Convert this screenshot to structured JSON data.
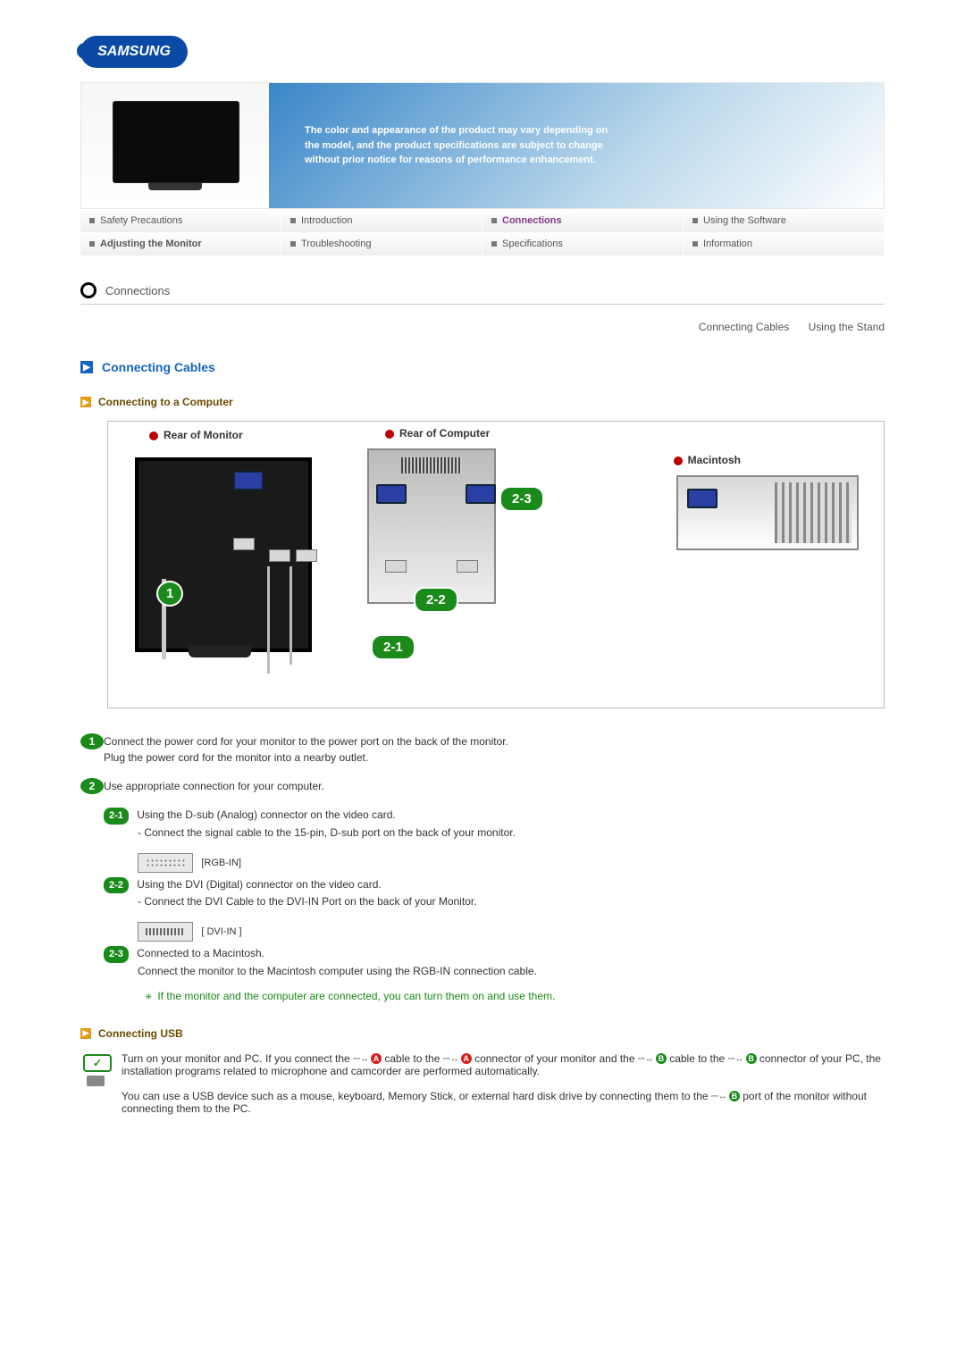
{
  "brand": "SAMSUNG",
  "hero": {
    "disclaimer": "The color and appearance of the product may vary depending on the model, and the product specifications are subject to change without prior notice for reasons of performance enhancement."
  },
  "tabs": {
    "row1": [
      "Safety Precautions",
      "Introduction",
      "Connections",
      "Using the Software"
    ],
    "row2": [
      "Adjusting the Monitor",
      "Troubleshooting",
      "Specifications",
      "Information"
    ]
  },
  "breadcrumb": "Connections",
  "subnav": [
    "Connecting Cables",
    "Using the Stand"
  ],
  "section": {
    "title": "Connecting Cables",
    "sub1": "Connecting to a Computer",
    "diagram": {
      "rear_monitor": "Rear of Monitor",
      "rear_computer": "Rear of Computer",
      "macintosh": "Macintosh",
      "c1": "1",
      "c21": "2-1",
      "c22": "2-2",
      "c23": "2-3"
    },
    "steps": {
      "s1a": "Connect the power cord for your monitor to the power port on the back of the monitor.",
      "s1b": "Plug the power cord for the monitor into a nearby outlet.",
      "s2": "Use appropriate connection for your computer.",
      "s21a": "Using the D-sub (Analog) connector on the video card.",
      "s21b": "- Connect the signal cable to the 15-pin, D-sub port on the back of your monitor.",
      "rgb": "[RGB-IN]",
      "s22a": "Using the DVI (Digital) connector on the video card.",
      "s22b": "- Connect the DVI Cable to the DVI-IN Port on the back of your Monitor.",
      "dvi": "[ DVI-IN ]",
      "s23a": "Connected to a Macintosh.",
      "s23b": "Connect the monitor to the Macintosh computer using the RGB-IN connection cable.",
      "note": "If the monitor and the computer are connected, you can turn them on and use them."
    },
    "sub2": "Connecting USB",
    "usb": {
      "p1a": "Turn on your monitor and PC. If you connect the ",
      "p1b": " cable to the ",
      "p1c": " connector of your monitor and the ",
      "p1d": " cable to the ",
      "p1e": " connector of your PC, the installation programs related to microphone and camcorder are performed automatically.",
      "p2a": "You can use a USB device such as a mouse, keyboard, Memory Stick, or external hard disk drive by connecting them to the ",
      "p2b": " port of the monitor without connecting them to the PC.",
      "labelA": "A",
      "labelB": "B"
    }
  }
}
